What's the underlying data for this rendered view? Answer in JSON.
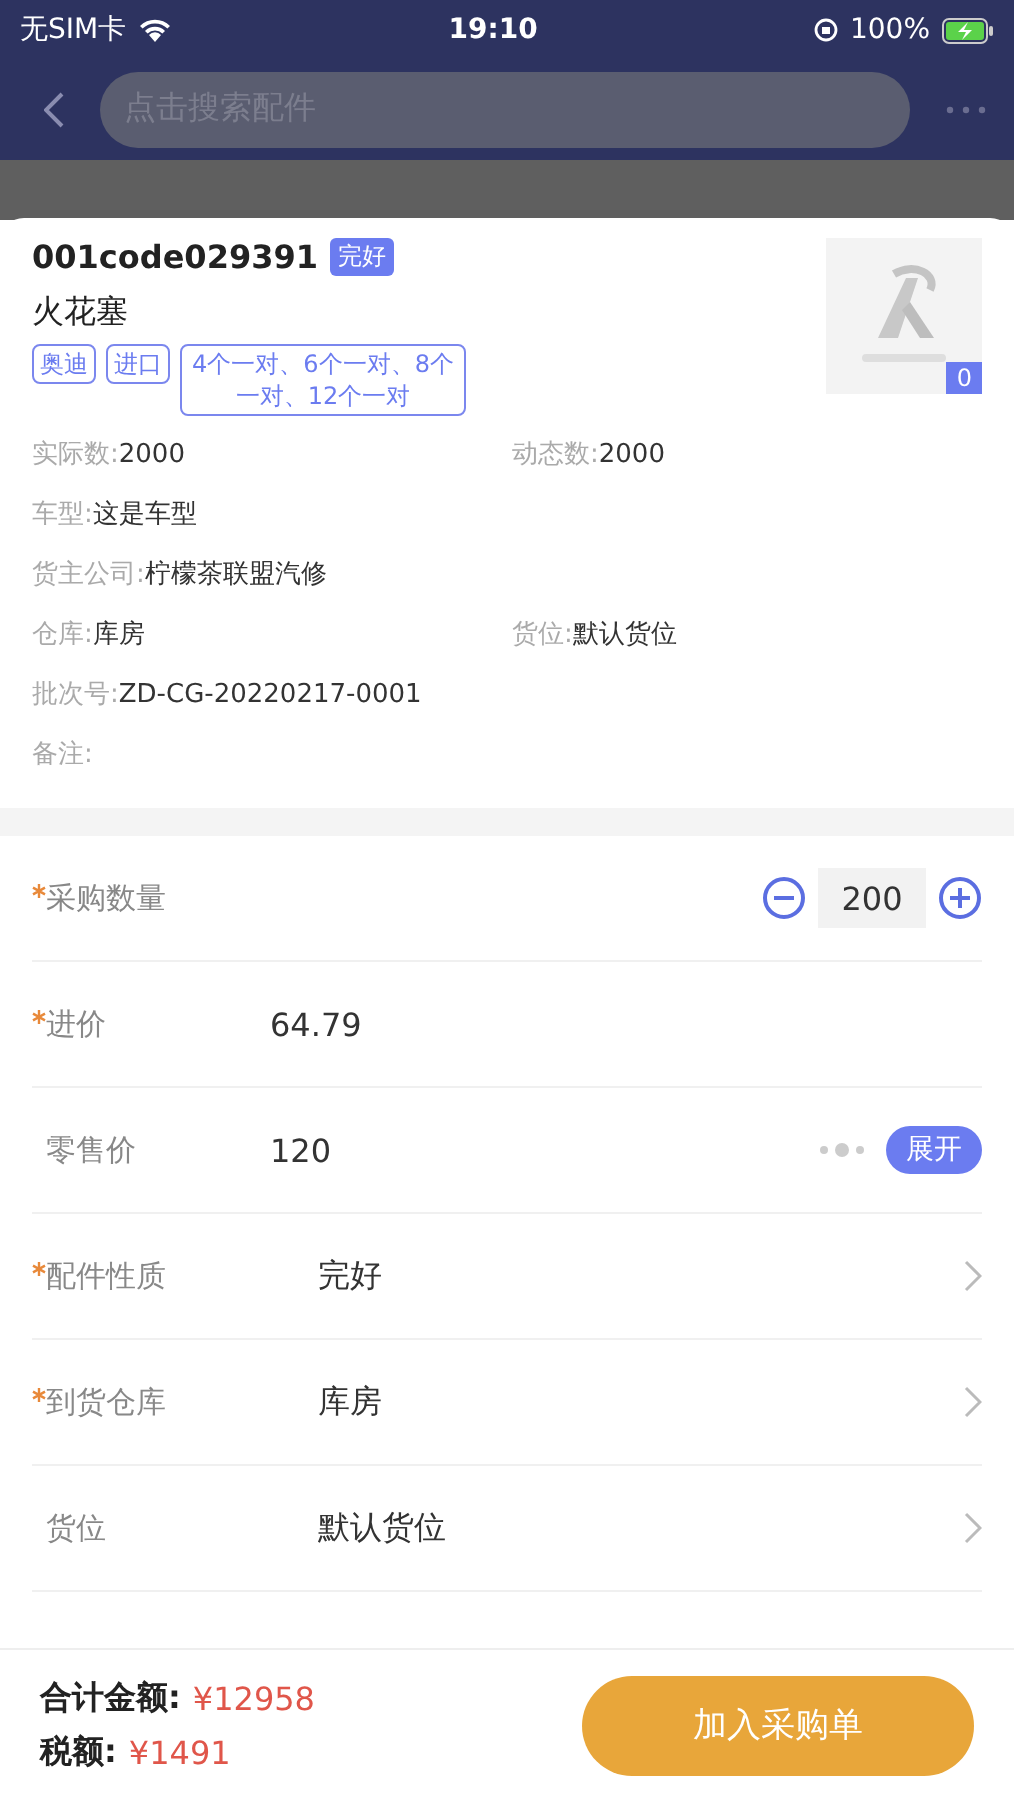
{
  "status_bar": {
    "carrier": "无SIM卡",
    "time": "19:10",
    "battery": "100%"
  },
  "nav": {
    "search": {
      "placeholder": "点击搜索配件"
    }
  },
  "part": {
    "code": "001code029391",
    "condition": "完好",
    "name": "火花塞",
    "tags": [
      "奥迪",
      "进口",
      "4个一对、6个一对、8个一对、12个一对"
    ],
    "thumbnail": {
      "kind": "picture",
      "count": "0"
    },
    "info": [
      {
        "items": [
          {
            "label": "实际数:",
            "value": "2000"
          },
          {
            "label": "动态数:",
            "value": "2000"
          }
        ]
      },
      {
        "items": [
          {
            "label": "车型:",
            "value": "这是车型"
          }
        ]
      },
      {
        "items": [
          {
            "label": "货主公司:",
            "value": "柠檬茶联盟汽修"
          }
        ]
      },
      {
        "items": [
          {
            "label": "仓库:",
            "value": "库房"
          },
          {
            "label": "货位:",
            "value": "默认货位"
          }
        ]
      },
      {
        "items": [
          {
            "label": "批次号:",
            "value": "ZD-CG-20220217-0001"
          }
        ]
      },
      {
        "items": [
          {
            "label": "备注:"
          }
        ]
      }
    ]
  },
  "fields": [
    {
      "kind": "stepper",
      "label": "采购数量",
      "required": true,
      "value": "200"
    },
    {
      "kind": "text",
      "label": "进价",
      "required": true,
      "value": "64.79"
    },
    {
      "kind": "expand",
      "label": "零售价",
      "required": false,
      "value": "120",
      "action": "展开"
    },
    {
      "kind": "select",
      "label": "配件性质",
      "required": true,
      "value": "完好"
    },
    {
      "kind": "select",
      "label": "到货仓库",
      "required": true,
      "value": "库房"
    },
    {
      "kind": "select",
      "label": "货位",
      "required": false,
      "value": "默认货位"
    }
  ],
  "footer": {
    "total_label": "合计金额:",
    "total": "¥12958",
    "tax_label": "税额:",
    "tax": "¥1491",
    "button": "加入采购单"
  }
}
